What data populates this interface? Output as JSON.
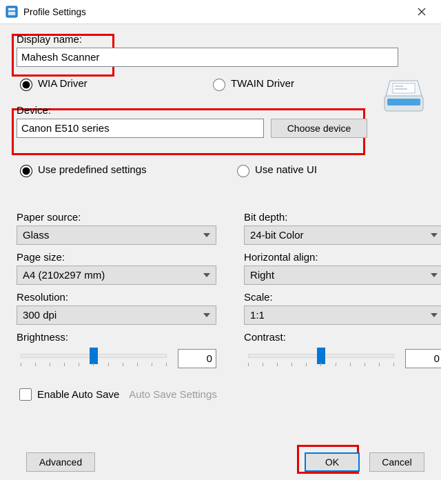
{
  "window": {
    "title": "Profile Settings"
  },
  "display_name": {
    "label": "Display name:",
    "value": "Mahesh Scanner"
  },
  "driver": {
    "wia": {
      "label": "WIA Driver",
      "selected": true
    },
    "twain": {
      "label": "TWAIN Driver",
      "selected": false
    }
  },
  "device": {
    "label": "Device:",
    "value": "Canon E510 series",
    "choose_label": "Choose device"
  },
  "settings_mode": {
    "predefined": {
      "label": "Use predefined settings",
      "selected": true
    },
    "native": {
      "label": "Use native UI",
      "selected": false
    }
  },
  "left_col": {
    "paper_source": {
      "label": "Paper source:",
      "value": "Glass"
    },
    "page_size": {
      "label": "Page size:",
      "value": "A4 (210x297 mm)"
    },
    "resolution": {
      "label": "Resolution:",
      "value": "300 dpi"
    },
    "brightness": {
      "label": "Brightness:",
      "value": "0"
    }
  },
  "right_col": {
    "bit_depth": {
      "label": "Bit depth:",
      "value": "24-bit Color"
    },
    "horiz_align": {
      "label": "Horizontal align:",
      "value": "Right"
    },
    "scale": {
      "label": "Scale:",
      "value": "1:1"
    },
    "contrast": {
      "label": "Contrast:",
      "value": "0"
    }
  },
  "autosave": {
    "enable_label": "Enable Auto Save",
    "checked": false,
    "settings_label": "Auto Save Settings"
  },
  "buttons": {
    "advanced": "Advanced",
    "ok": "OK",
    "cancel": "Cancel"
  },
  "icons": {
    "app": "scan-app-icon",
    "scanner": "scanner-icon",
    "chevron": "chevron-down-icon",
    "close": "close-icon"
  }
}
